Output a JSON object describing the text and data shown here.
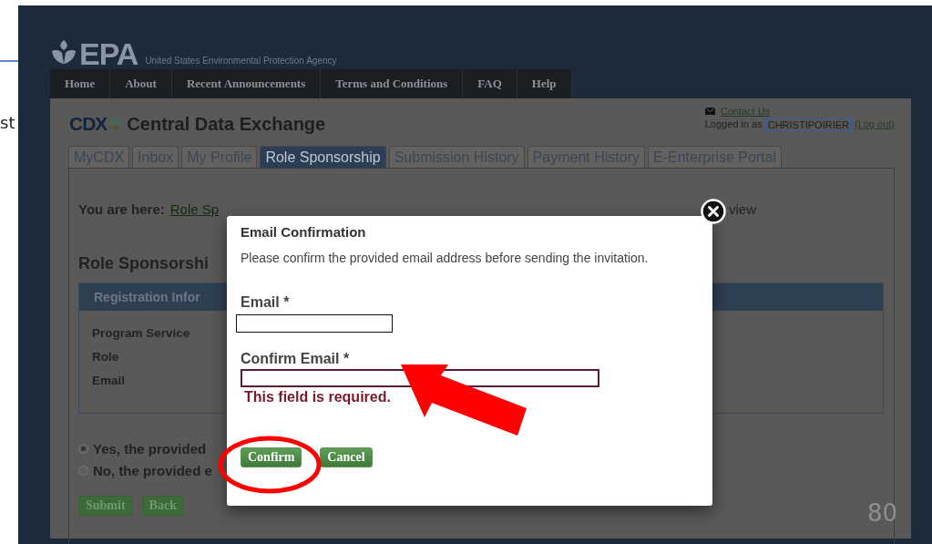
{
  "slide": {
    "edge_text": "st",
    "page_number": "80"
  },
  "agency": {
    "logo": "EPA",
    "name": "United States Environmental Protection Agency"
  },
  "nav": [
    {
      "label": "Home"
    },
    {
      "label": "About"
    },
    {
      "label": "Recent Announcements"
    },
    {
      "label": "Terms and Conditions"
    },
    {
      "label": "FAQ"
    },
    {
      "label": "Help"
    }
  ],
  "site": {
    "logo": "CDX",
    "title": "Central Data Exchange",
    "contact": "Contact Us",
    "logged_in_label": "Logged in as",
    "user": "CHRISTIPOIRIER",
    "logout": "(Log out)"
  },
  "tabs": [
    {
      "label": "MyCDX",
      "selected": false
    },
    {
      "label": "Inbox",
      "selected": false
    },
    {
      "label": "My Profile",
      "selected": false
    },
    {
      "label": "Role Sponsorship",
      "selected": true
    },
    {
      "label": "Submission History",
      "selected": false
    },
    {
      "label": "Payment History",
      "selected": false
    },
    {
      "label": "E-Enterprise Portal",
      "selected": false
    }
  ],
  "breadcrumb": {
    "label": "You are here:",
    "link": "Role Sp",
    "tail": "view"
  },
  "heading": "Role Sponsorshi",
  "panel": {
    "title": "Registration Infor",
    "fields": [
      "Program Service",
      "Role",
      "Email"
    ]
  },
  "options": [
    {
      "label": "Yes, the provided",
      "selected": true
    },
    {
      "label": "No, the provided e",
      "selected": false
    }
  ],
  "page_buttons": [
    "Submit",
    "Back"
  ],
  "dialog": {
    "title": "Email Confirmation",
    "message": "Please confirm the provided email address before sending the invitation.",
    "fields": [
      {
        "label": "Email *",
        "invalid": false
      },
      {
        "label": "Confirm Email *",
        "invalid": true,
        "error": "This field is required."
      }
    ],
    "buttons": [
      "Confirm",
      "Cancel"
    ]
  }
}
